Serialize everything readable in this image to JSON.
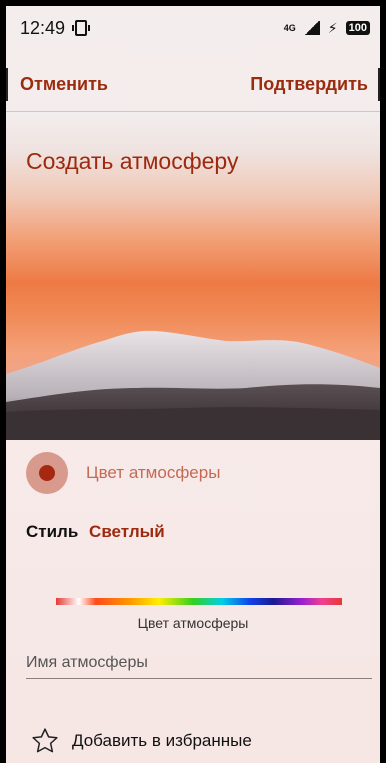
{
  "status_bar": {
    "time": "12:49",
    "network": "4G",
    "battery": "100"
  },
  "header": {
    "cancel_label": "Отменить",
    "confirm_label": "Подтвердить"
  },
  "hero": {
    "title": "Создать атмосферу"
  },
  "color": {
    "label": "Цвет атмосферы",
    "selected": "#a72810"
  },
  "style": {
    "label": "Стиль",
    "value": "Светлый"
  },
  "spectrum": {
    "caption": "Цвет атмосферы"
  },
  "name_input": {
    "placeholder": "Имя атмосферы",
    "value": ""
  },
  "favorite": {
    "label": "Добавить в избранные"
  },
  "colors": {
    "accent": "#9c2a10",
    "accent_light": "#c46a55"
  }
}
